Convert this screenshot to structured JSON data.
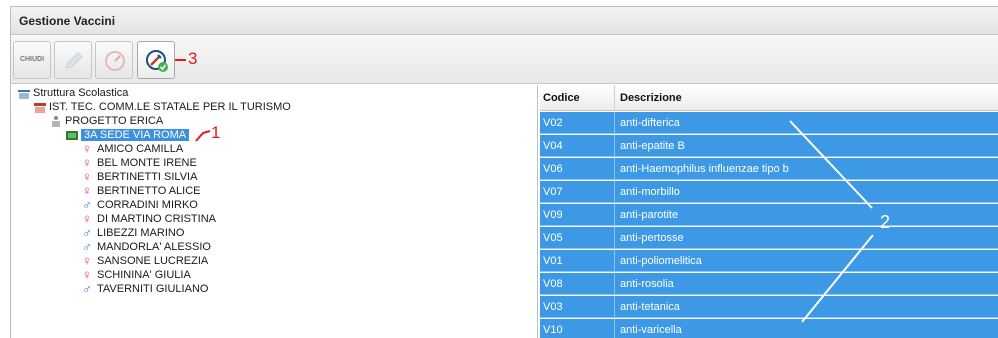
{
  "window": {
    "title": "Gestione Vaccini"
  },
  "toolbar": {
    "close_label": "CHIUDI",
    "buttons": [
      {
        "name": "close-button",
        "icon": ""
      },
      {
        "name": "edit-button",
        "icon": "pencil-icon"
      },
      {
        "name": "gauge-button",
        "icon": "gauge-icon"
      },
      {
        "name": "vaccine-button",
        "icon": "syringe-check-icon"
      }
    ]
  },
  "callouts": {
    "one": "1",
    "two": "2",
    "three": "3"
  },
  "tree": {
    "root": "Struttura Scolastica",
    "school": "IST. TEC. COMM.LE STATALE PER IL TURISMO",
    "project": "PROGETTO ERICA",
    "class": "3A SEDE VIA ROMA",
    "students": [
      {
        "name": "AMICO CAMILLA",
        "gender": "F"
      },
      {
        "name": "BEL MONTE IRENE",
        "gender": "F"
      },
      {
        "name": "BERTINETTI SILVIA",
        "gender": "F"
      },
      {
        "name": "BERTINETTO ALICE",
        "gender": "F"
      },
      {
        "name": "CORRADINI MIRKO",
        "gender": "M"
      },
      {
        "name": "DI MARTINO CRISTINA",
        "gender": "F"
      },
      {
        "name": "LIBEZZI MARINO",
        "gender": "M"
      },
      {
        "name": "MANDORLA' ALESSIO",
        "gender": "M"
      },
      {
        "name": "SANSONE LUCREZIA",
        "gender": "F"
      },
      {
        "name": "SCHININA' GIULIA",
        "gender": "F"
      },
      {
        "name": "TAVERNITI GIULIANO",
        "gender": "M"
      }
    ]
  },
  "grid": {
    "columns": [
      "Codice",
      "Descrizione"
    ],
    "rows": [
      {
        "code": "V02",
        "desc": "anti-difterica"
      },
      {
        "code": "V04",
        "desc": "anti-epatite B"
      },
      {
        "code": "V06",
        "desc": "anti-Haemophilus influenzae tipo b"
      },
      {
        "code": "V07",
        "desc": "anti-morbillo"
      },
      {
        "code": "V09",
        "desc": "anti-parotite"
      },
      {
        "code": "V05",
        "desc": "anti-pertosse"
      },
      {
        "code": "V01",
        "desc": "anti-poliomelitica"
      },
      {
        "code": "V08",
        "desc": "anti-rosolia"
      },
      {
        "code": "V03",
        "desc": "anti-tetanica"
      },
      {
        "code": "V10",
        "desc": "anti-varicella"
      }
    ]
  },
  "colors": {
    "selection": "#3d99e6",
    "female": "#e0427a",
    "male": "#2f7fd4",
    "callout": "#e31a1a"
  }
}
